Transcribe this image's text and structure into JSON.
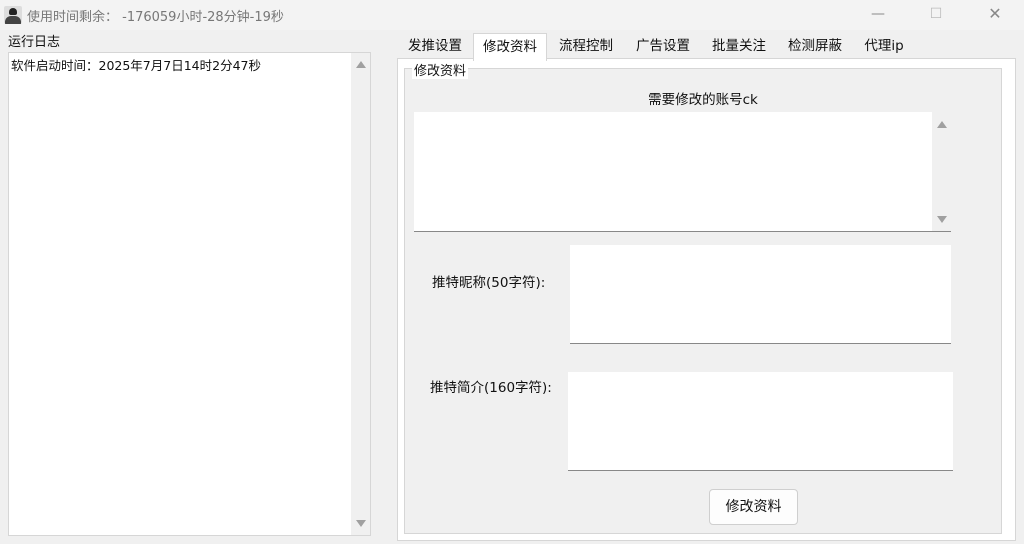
{
  "window": {
    "title": "使用时间剩余： -176059小时-28分钟-19秒",
    "minimize": "—",
    "maximize": "☐",
    "close": "✕"
  },
  "log": {
    "label": "运行日志",
    "text": "软件启动时间：2025年7月7日14时2分47秒"
  },
  "tabs": [
    {
      "label": "发推设置"
    },
    {
      "label": "修改资料"
    },
    {
      "label": "流程控制"
    },
    {
      "label": "广告设置"
    },
    {
      "label": "批量关注"
    },
    {
      "label": "检测屏蔽"
    },
    {
      "label": "代理ip"
    }
  ],
  "profile": {
    "group_title": "修改资料",
    "ck_label": "需要修改的账号ck",
    "ck_value": "",
    "nickname_label": "推特昵称(50字符):",
    "nickname_value": "",
    "bio_label": "推特简介(160字符):",
    "bio_value": "",
    "submit_label": "修改资料"
  }
}
